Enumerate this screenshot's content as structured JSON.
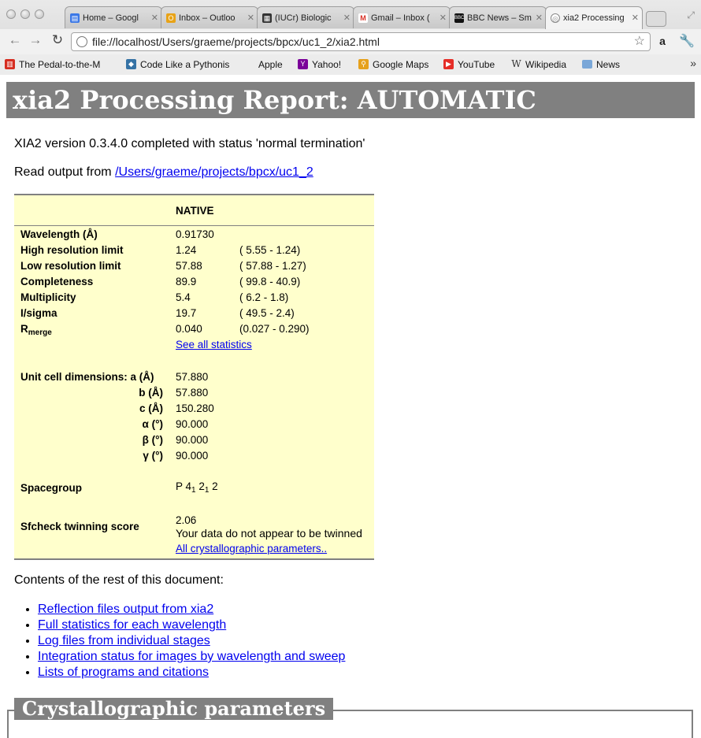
{
  "browser": {
    "tabs": [
      {
        "label": "Home – Googl",
        "favicon": "google-docs-icon",
        "color": "#3b78e7"
      },
      {
        "label": "Inbox – Outloo",
        "favicon": "outlook-icon",
        "color": "#e8a317"
      },
      {
        "label": "(IUCr) Biologic",
        "favicon": "iucr-icon",
        "color": "#333333"
      },
      {
        "label": "Gmail – Inbox (",
        "favicon": "gmail-icon",
        "color": "#d93025"
      },
      {
        "label": "BBC News – Sm",
        "favicon": "bbc-icon",
        "color": "#111111"
      },
      {
        "label": "xia2 Processing",
        "favicon": "globe-icon",
        "color": "#888888",
        "active": true
      }
    ],
    "url": "file://localhost/Users/graeme/projects/bpcx/uc1_2/xia2.html",
    "bookmarks": [
      {
        "label": "The Pedal-to-the-M",
        "icon": "pedal-icon",
        "color": "#d62d20"
      },
      {
        "label": "Code Like a Pythonis",
        "icon": "python-icon",
        "color": "#3572a5"
      },
      {
        "label": "Apple",
        "icon": "apple-icon",
        "color": "#555555"
      },
      {
        "label": "Yahoo!",
        "icon": "yahoo-icon",
        "color": "#7b0099"
      },
      {
        "label": "Google Maps",
        "icon": "google-maps-icon",
        "color": "#e6a11c"
      },
      {
        "label": "YouTube",
        "icon": "youtube-icon",
        "color": "#e52d27"
      },
      {
        "label": "Wikipedia",
        "icon": "wikipedia-icon",
        "color": "#444444"
      },
      {
        "label": "News",
        "icon": "folder-icon",
        "color": "#7aa7d8"
      }
    ]
  },
  "page": {
    "title": "xia2 Processing Report: AUTOMATIC",
    "status_line": "XIA2 version 0.3.4.0 completed with status 'normal termination'",
    "read_output_prefix": "Read output from ",
    "read_output_link": "/Users/graeme/projects/bpcx/uc1_2",
    "summary": {
      "header": "NATIVE",
      "rows": [
        {
          "label": "Wavelength (Å)",
          "value": "0.91730",
          "range": ""
        },
        {
          "label": "High resolution limit",
          "value": "1.24",
          "range": "( 5.55 - 1.24)"
        },
        {
          "label": "Low resolution limit",
          "value": "57.88",
          "range": "( 57.88 - 1.27)"
        },
        {
          "label": "Completeness",
          "value": "89.9",
          "range": "( 99.8 - 40.9)"
        },
        {
          "label": "Multiplicity",
          "value": "5.4",
          "range": "( 6.2 - 1.8)"
        },
        {
          "label": "I/sigma",
          "value": "19.7",
          "range": "( 49.5 - 2.4)"
        },
        {
          "label": "R",
          "label_sub": "merge",
          "value": "0.040",
          "range": "(0.027 - 0.290)"
        }
      ],
      "see_all_statistics": "See all statistics",
      "unit_cell_label": "Unit cell dimensions: a (Å)",
      "unit_cell": [
        {
          "label": "a (Å)",
          "value": "57.880"
        },
        {
          "label": "b (Å)",
          "value": "57.880"
        },
        {
          "label": "c (Å)",
          "value": "150.280"
        },
        {
          "label": "α (°)",
          "value": "90.000"
        },
        {
          "label": "β (°)",
          "value": "90.000"
        },
        {
          "label": "γ (°)",
          "value": "90.000"
        }
      ],
      "spacegroup_label": "Spacegroup",
      "spacegroup": {
        "p": "P 4",
        "s1": "1",
        "m": " 2",
        "s2": "1",
        "e": " 2"
      },
      "twinning_label": "Sfcheck twinning score",
      "twinning_score": "2.06",
      "twinning_text": "Your data do not appear to be twinned",
      "all_params_link": "All crystallographic parameters.."
    },
    "contents_intro": "Contents of the rest of this document:",
    "contents": [
      "Reflection files output from xia2",
      "Full statistics for each wavelength",
      "Log files from individual stages",
      "Integration status for images by wavelength and sweep",
      "Lists of programs and citations"
    ],
    "section_title": "Crystallographic parameters"
  }
}
